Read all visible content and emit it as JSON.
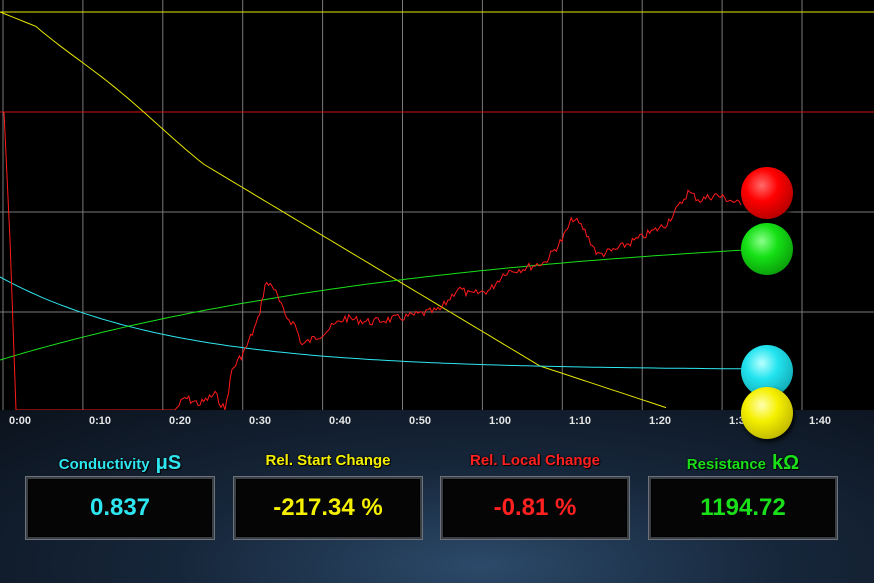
{
  "timeline": {
    "ticks": [
      "0:00",
      "0:10",
      "0:20",
      "0:30",
      "0:40",
      "0:50",
      "1:00",
      "1:10",
      "1:20",
      "1:30",
      "1:40"
    ]
  },
  "metrics": {
    "conductivity": {
      "label": "Conductivity",
      "unit": "μS",
      "value": "0.837",
      "color": "#2ee6f0"
    },
    "rel_start": {
      "label": "Rel. Start Change",
      "value": "-217.34 %",
      "color": "#f5f000"
    },
    "rel_local": {
      "label": "Rel. Local Change",
      "value": "-0.81 %",
      "color": "#ff2020"
    },
    "resistance": {
      "label": "Resistance",
      "unit": "kΩ",
      "value": "1194.72",
      "color": "#19e019"
    }
  },
  "indicators": [
    {
      "name": "red-indicator",
      "color": "red"
    },
    {
      "name": "green-indicator",
      "color": "green"
    },
    {
      "name": "cyan-indicator",
      "color": "cyan"
    },
    {
      "name": "yellow-indicator",
      "color": "yellow"
    }
  ]
}
